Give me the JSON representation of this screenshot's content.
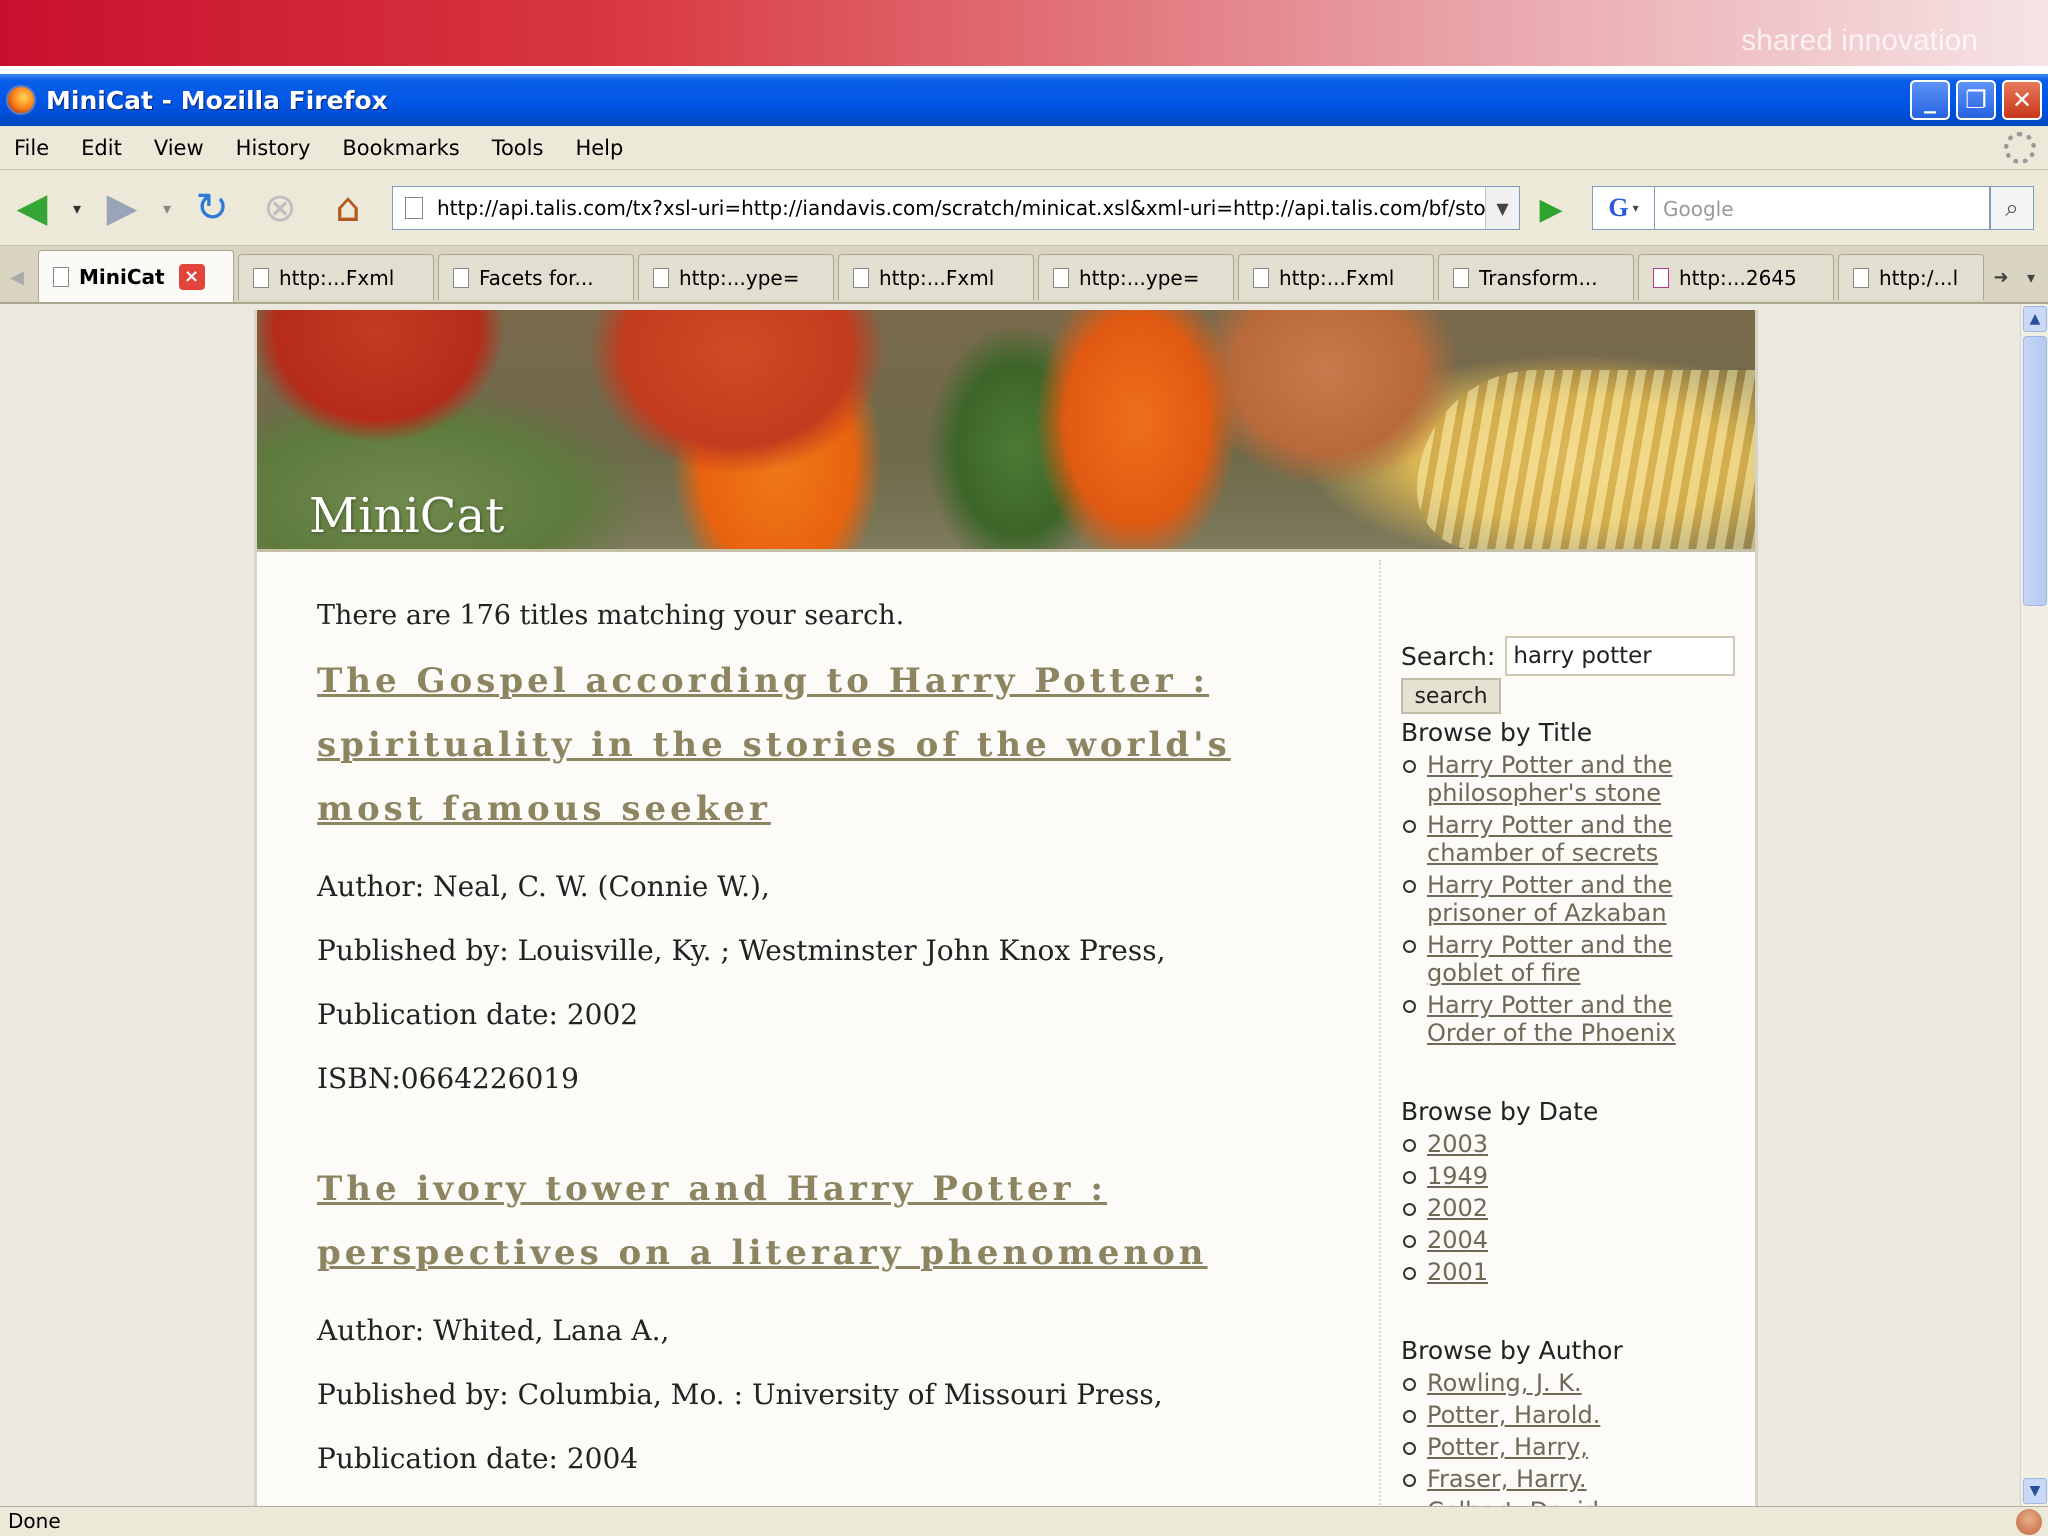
{
  "banner": {
    "tagline": "shared innovation"
  },
  "window": {
    "title": "MiniCat - Mozilla Firefox"
  },
  "menu": [
    "File",
    "Edit",
    "View",
    "History",
    "Bookmarks",
    "Tools",
    "Help"
  ],
  "nav": {
    "url": "http://api.talis.com/tx?xsl-uri=http://iandavis.com/scratch/minicat.xsl&xml-uri=http://api.talis.com/bf/stores",
    "search_placeholder": "Google"
  },
  "tabs": [
    {
      "label": "MiniCat",
      "active": true
    },
    {
      "label": "http:...Fxml"
    },
    {
      "label": "Facets for..."
    },
    {
      "label": "http:...ype="
    },
    {
      "label": "http:...Fxml"
    },
    {
      "label": "http:...ype="
    },
    {
      "label": "http:...Fxml"
    },
    {
      "label": "Transform..."
    },
    {
      "label": "http:...2645"
    },
    {
      "label": "http:/...l"
    }
  ],
  "page": {
    "site_title": "MiniCat",
    "summary": "There are 176 titles matching your search.",
    "books": [
      {
        "title": "The Gospel according to Harry Potter : spirituality in the stories of the world's most famous seeker",
        "author": "Author: Neal, C. W. (Connie W.),",
        "publisher": "Published by: Louisville, Ky. ; Westminster John Knox Press,",
        "date": "Publication date: 2002",
        "isbn": "ISBN:0664226019"
      },
      {
        "title": "The ivory tower and Harry Potter : perspectives on a literary phenomenon",
        "author": "Author: Whited, Lana A.,",
        "publisher": "Published by: Columbia, Mo. : University of Missouri Press,",
        "date": "Publication date: 2004"
      }
    ],
    "sidebar": {
      "search_label": "Search:",
      "search_value": "harry potter",
      "search_button": "search",
      "browse_title_heading": "Browse by Title",
      "titles": [
        "Harry Potter and the philosopher's stone",
        "Harry Potter and the chamber of secrets",
        "Harry Potter and the prisoner of Azkaban",
        "Harry Potter and the goblet of fire",
        "Harry Potter and the Order of the Phoenix"
      ],
      "browse_date_heading": "Browse by Date",
      "dates": [
        "2003",
        "1949",
        "2002",
        "2004",
        "2001"
      ],
      "browse_author_heading": "Browse by Author",
      "authors": [
        "Rowling, J. K.",
        "Potter, Harold.",
        "Potter, Harry,",
        "Fraser, Harry.",
        "Colbert, David."
      ]
    }
  },
  "status": {
    "text": "Done"
  }
}
